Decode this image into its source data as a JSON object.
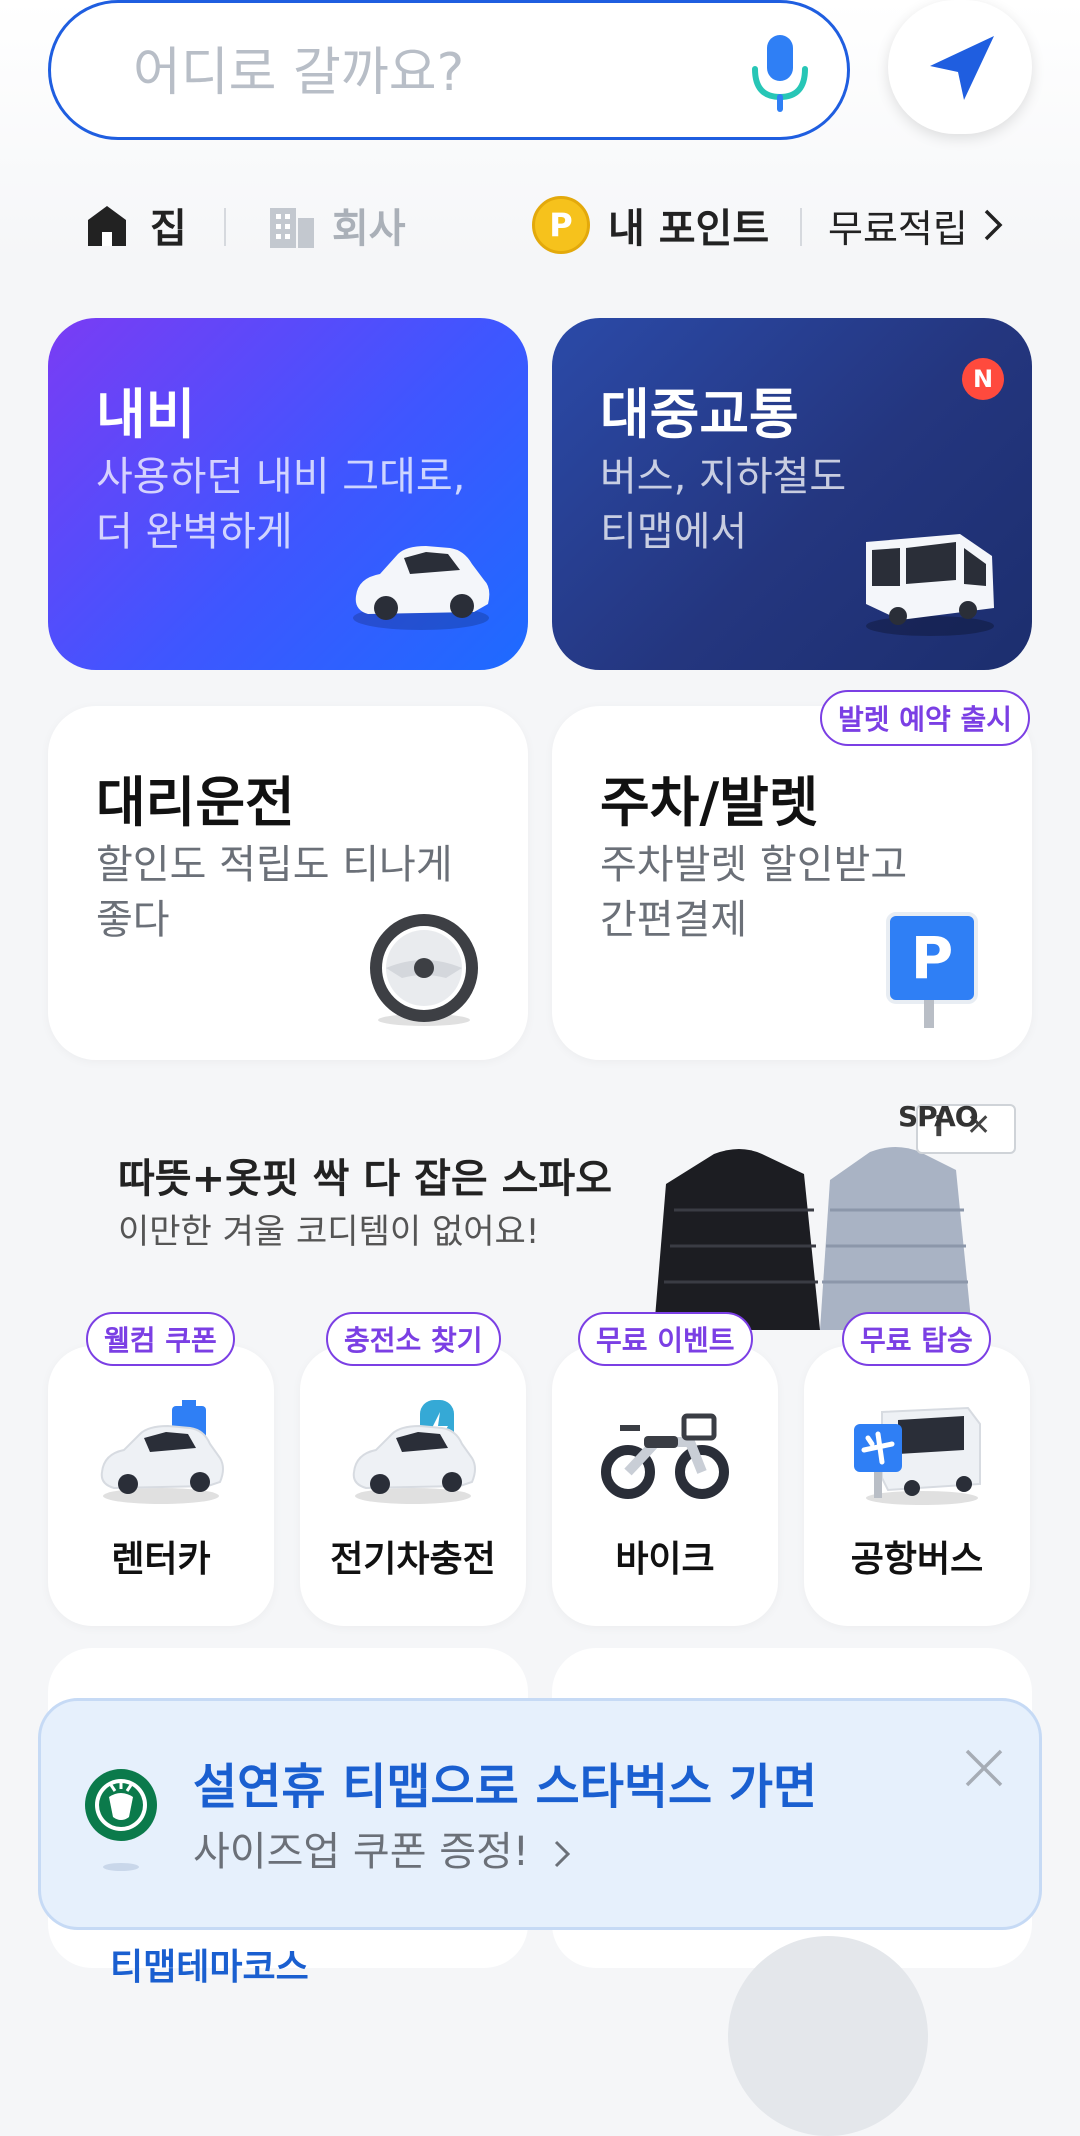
{
  "search": {
    "placeholder": "어디로 갈까요?"
  },
  "shortcuts": {
    "home": "집",
    "work": "회사",
    "points_label": "내 포인트",
    "points_icon_letter": "P",
    "free_earn": "무료적립"
  },
  "services": [
    {
      "title": "내비",
      "subtitle_lines": [
        "사용하던 내비 그대로,",
        "더 완벽하게"
      ],
      "icon": "car-icon"
    },
    {
      "title": "대중교통",
      "subtitle_lines": [
        "버스, 지하철도",
        "티맵에서"
      ],
      "badge": "N",
      "icon": "bus-icon"
    },
    {
      "title": "대리운전",
      "subtitle_lines": [
        "할인도 적립도 티나게",
        "좋다"
      ],
      "icon": "steering-wheel-icon"
    },
    {
      "title": "주차/발렛",
      "subtitle_lines": [
        "주차발렛 할인받고",
        "간편결제"
      ],
      "tag": "발렛 예약 출시",
      "icon": "parking-sign-icon",
      "sign_letter": "P"
    }
  ],
  "ad": {
    "headline": "따뜻+옷핏 싹 다 잡은 스파오",
    "subline": "이만한 겨울 코디템이 없어요!",
    "brand": "SPAO",
    "info_glyph": "i",
    "close_glyph": "✕"
  },
  "quick": [
    {
      "label": "렌터카",
      "tag": "웰컴 쿠폰",
      "icon": "rental-car-icon"
    },
    {
      "label": "전기차충전",
      "tag": "충전소 찾기",
      "icon": "ev-charging-icon"
    },
    {
      "label": "바이크",
      "tag": "무료 이벤트",
      "icon": "bike-icon"
    },
    {
      "label": "공항버스",
      "tag": "무료 탑승",
      "icon": "airport-bus-icon"
    }
  ],
  "toast": {
    "title": "설연휴 티맵으로 스타벅스 가면",
    "subtitle": "사이즈업 쿠폰 증정!",
    "icon": "starbucks-logo"
  },
  "peek_text": "티맵테마코스",
  "colors": {
    "accent": "#1f5ee0",
    "purple": "#7b3fe4",
    "navi_gradient": [
      "#7a3cf4",
      "#1d6bff"
    ],
    "transit_gradient": [
      "#2b4aa8",
      "#1c2e6e"
    ]
  }
}
